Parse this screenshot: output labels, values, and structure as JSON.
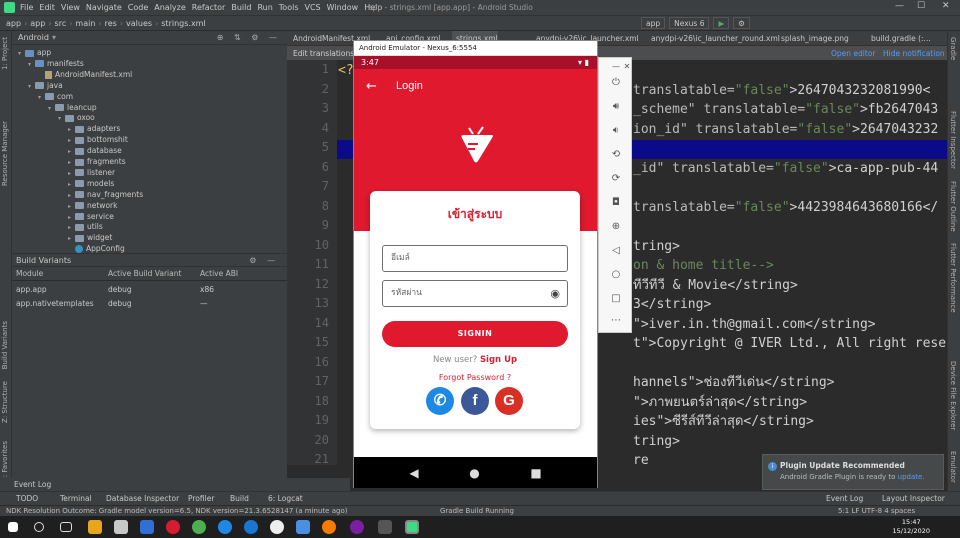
{
  "menubar": {
    "items": [
      "File",
      "Edit",
      "View",
      "Navigate",
      "Code",
      "Analyze",
      "Refactor",
      "Build",
      "Run",
      "Tools",
      "VCS",
      "Window",
      "Help"
    ],
    "window_title": "app - strings.xml [app.app] - Android Studio"
  },
  "navbar": {
    "crumbs": [
      "app",
      "app",
      "src",
      "main",
      "res",
      "values",
      "strings.xml"
    ],
    "run_config": "app",
    "device": "Nexus 6"
  },
  "project_panel": {
    "view": "Android",
    "tree": [
      {
        "label": "app",
        "depth": 0,
        "kind": "module"
      },
      {
        "label": "manifests",
        "depth": 1,
        "kind": "folder"
      },
      {
        "label": "AndroidManifest.xml",
        "depth": 2,
        "kind": "file"
      },
      {
        "label": "java",
        "depth": 1,
        "kind": "folder"
      },
      {
        "label": "com",
        "depth": 2,
        "kind": "folder"
      },
      {
        "label": "leancup",
        "depth": 3,
        "kind": "folder"
      },
      {
        "label": "oxoo",
        "depth": 4,
        "kind": "folder"
      },
      {
        "label": "adapters",
        "depth": 5,
        "kind": "folder"
      },
      {
        "label": "bottomshit",
        "depth": 5,
        "kind": "folder"
      },
      {
        "label": "database",
        "depth": 5,
        "kind": "folder"
      },
      {
        "label": "fragments",
        "depth": 5,
        "kind": "folder"
      },
      {
        "label": "listener",
        "depth": 5,
        "kind": "folder"
      },
      {
        "label": "models",
        "depth": 5,
        "kind": "folder"
      },
      {
        "label": "nav_fragments",
        "depth": 5,
        "kind": "folder"
      },
      {
        "label": "network",
        "depth": 5,
        "kind": "folder"
      },
      {
        "label": "service",
        "depth": 5,
        "kind": "folder"
      },
      {
        "label": "utils",
        "depth": 5,
        "kind": "folder"
      },
      {
        "label": "widget",
        "depth": 5,
        "kind": "folder"
      },
      {
        "label": "AppConfig",
        "depth": 5,
        "kind": "class"
      }
    ]
  },
  "build_variants": {
    "title": "Build Variants",
    "columns": [
      "Module",
      "Active Build Variant",
      "Active ABI"
    ],
    "rows": [
      [
        "app.app",
        "debug",
        "x86"
      ],
      [
        "app.nativetemplates",
        "debug",
        "—"
      ]
    ]
  },
  "editor_tabs": [
    "AndroidManifest.xml",
    "api_config.xml",
    "strings.xml",
    "anydpi-v26\\ic_launcher.xml",
    "anydpi-v26\\ic_launcher_round.xml",
    "splash_image.png",
    "build.gradle (:..."
  ],
  "notification_bar": {
    "text": "Edit translations f",
    "open_editor": "Open editor",
    "hide": "Hide notification"
  },
  "code": {
    "line_numbers": [
      "1",
      "2",
      "3",
      "4",
      "5",
      "6",
      "7",
      "8",
      "9",
      "10",
      "11",
      "12",
      "13",
      "14",
      "15",
      "16",
      "17",
      "18",
      "19",
      "20",
      "21"
    ],
    "lines": [
      {
        "n": 1,
        "parts": [
          {
            "t": "<?",
            "c": "c-tag"
          }
        ]
      },
      {
        "n": 2,
        "parts": [
          {
            "t": "translatable=",
            "c": "c-attr"
          },
          {
            "t": "\"false\"",
            "c": "c-str"
          },
          {
            "t": ">2647043232081990<",
            "c": "c-txt"
          }
        ]
      },
      {
        "n": 3,
        "parts": [
          {
            "t": "_scheme\" translatable=",
            "c": "c-attr"
          },
          {
            "t": "\"false\"",
            "c": "c-str"
          },
          {
            "t": ">fb2647043",
            "c": "c-txt"
          }
        ]
      },
      {
        "n": 4,
        "parts": [
          {
            "t": "ion_id\" translatable=",
            "c": "c-attr"
          },
          {
            "t": "\"false\"",
            "c": "c-str"
          },
          {
            "t": ">2647043232",
            "c": "c-txt"
          }
        ]
      },
      {
        "n": 5,
        "parts": []
      },
      {
        "n": 6,
        "parts": [
          {
            "t": "_id\" translatable=",
            "c": "c-attr"
          },
          {
            "t": "\"false\"",
            "c": "c-str"
          },
          {
            "t": ">ca-app-pub-44",
            "c": "c-txt"
          }
        ]
      },
      {
        "n": 7,
        "parts": []
      },
      {
        "n": 8,
        "parts": [
          {
            "t": "translatable=",
            "c": "c-attr"
          },
          {
            "t": "\"false\"",
            "c": "c-str"
          },
          {
            "t": ">4423984643680166</",
            "c": "c-txt"
          }
        ]
      },
      {
        "n": 9,
        "parts": []
      },
      {
        "n": 10,
        "parts": [
          {
            "t": "tring>",
            "c": "c-txt"
          }
        ]
      },
      {
        "n": 11,
        "parts": [
          {
            "t": "on & home title-->",
            "c": "c-str"
          }
        ]
      },
      {
        "n": 12,
        "parts": [
          {
            "t": "ทีวีทีวี & Movie</string>",
            "c": "c-txt"
          }
        ]
      },
      {
        "n": 13,
        "parts": [
          {
            "t": "3</string>",
            "c": "c-txt"
          }
        ]
      },
      {
        "n": 14,
        "parts": [
          {
            "t": "\">iver.in.th@gmail.com</string>",
            "c": "c-txt"
          }
        ]
      },
      {
        "n": 15,
        "parts": [
          {
            "t": "t\">Copyright @ IVER Ltd., All right reserve",
            "c": "c-txt"
          }
        ]
      },
      {
        "n": 16,
        "parts": []
      },
      {
        "n": 17,
        "parts": [
          {
            "t": "hannels\">ช่องทีวีเด่น</string>",
            "c": "c-txt"
          }
        ]
      },
      {
        "n": 18,
        "parts": [
          {
            "t": "\">ภาพยนตร์ล่าสุด</string>",
            "c": "c-txt"
          }
        ]
      },
      {
        "n": 19,
        "parts": [
          {
            "t": "ies\">ซีรีส์ทีวีล่าสุด</string>",
            "c": "c-txt"
          }
        ]
      },
      {
        "n": 20,
        "parts": [
          {
            "t": "tring>",
            "c": "c-txt"
          }
        ]
      },
      {
        "n": 21,
        "parts": [
          {
            "t": "re",
            "c": "c-txt"
          }
        ]
      }
    ]
  },
  "emulator": {
    "window_title": "Android Emulator - Nexus_6:5554",
    "status_time": "3:47",
    "appbar_title": "Login",
    "card_title": "เข้าสู่ระบบ",
    "email_placeholder": "อีเมล์",
    "password_placeholder": "รหัสผ่าน",
    "signin_label": "SIGNIN",
    "new_user_text": "New user?",
    "signup_label": "Sign Up",
    "forgot_label": "Forgot Password ?",
    "social": [
      {
        "name": "phone-login",
        "color": "#1e88e5",
        "glyph": "✆"
      },
      {
        "name": "facebook-login",
        "color": "#3b5998",
        "glyph": "f"
      },
      {
        "name": "google-login",
        "color": "#d93025",
        "glyph": "G"
      }
    ]
  },
  "bottom_tools": [
    "TODO",
    "Terminal",
    "Database Inspector",
    "Profiler",
    "Build",
    "6: Logcat"
  ],
  "bottom_tools_right": [
    "Event Log",
    "Layout Inspector"
  ],
  "event_log_label": "Event Log",
  "status_line": "NDK Resolution Outcome: Gradle model version=6.5, NDK version=21.3.6528147 (a minute ago)",
  "gradle_status": "Gradle Build Running",
  "cursor_info": "5:1  LF  UTF-8  4 spaces",
  "popup": {
    "title": "Plugin Update Recommended",
    "body": "Android Gradle Plugin is ready to",
    "link": "update."
  },
  "taskbar": {
    "time": "15:47",
    "date": "15/12/2020"
  },
  "left_strip_tabs": [
    "1: Project",
    "Resource Manager",
    "Build Variants",
    "Z: Structure",
    "2: Favorites"
  ],
  "right_strip_tabs": [
    "Gradle",
    "Flutter Inspector",
    "Flutter Outline",
    "Flutter Performance",
    "Device File Explorer",
    "Emulator"
  ]
}
